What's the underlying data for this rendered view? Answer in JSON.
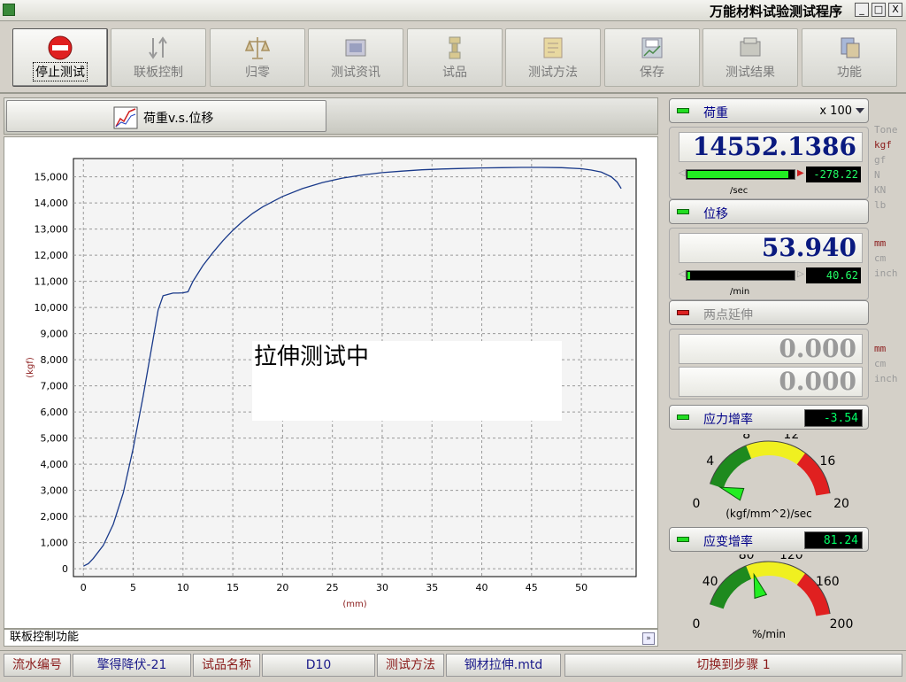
{
  "window": {
    "title": "万能材料试验测试程序",
    "btn_min": "_",
    "btn_max": "□",
    "btn_close": "X"
  },
  "toolbar": [
    {
      "label": "停止测试",
      "icon": "stop-icon",
      "active": true
    },
    {
      "label": "联板控制",
      "icon": "updown-icon",
      "active": false
    },
    {
      "label": "归零",
      "icon": "balance-icon",
      "active": false
    },
    {
      "label": "测试资讯",
      "icon": "info-icon",
      "active": false
    },
    {
      "label": "试品",
      "icon": "specimen-icon",
      "active": false
    },
    {
      "label": "测试方法",
      "icon": "method-icon",
      "active": false
    },
    {
      "label": "保存",
      "icon": "save-icon",
      "active": false
    },
    {
      "label": "测试结果",
      "icon": "results-icon",
      "active": false
    },
    {
      "label": "功能",
      "icon": "function-icon",
      "active": false
    }
  ],
  "tab": {
    "label": "荷重v.s.位移"
  },
  "overlay": {
    "text": "拉伸测试中"
  },
  "status_line": {
    "text": "联板控制功能",
    "expand": "»"
  },
  "chart_data": {
    "type": "line",
    "title": "",
    "xlabel": "(mm)",
    "ylabel": "(kgf)",
    "xlim": [
      -1,
      55.5
    ],
    "ylim": [
      -300,
      15700
    ],
    "x_ticks": [
      0,
      5,
      10,
      15,
      20,
      25,
      30,
      35,
      40,
      45,
      50
    ],
    "y_ticks": [
      0,
      1000,
      2000,
      3000,
      4000,
      5000,
      6000,
      7000,
      8000,
      9000,
      10000,
      11000,
      12000,
      13000,
      14000,
      15000
    ],
    "y_tick_labels": [
      "0",
      "1,000",
      "2,000",
      "3,000",
      "4,000",
      "5,000",
      "6,000",
      "7,000",
      "8,000",
      "9,000",
      "10,000",
      "11,000",
      "12,000",
      "13,000",
      "14,000",
      "15,000"
    ],
    "grid": true,
    "color": "#1a3a8a",
    "series": [
      {
        "x": [
          0,
          0.5,
          1,
          2,
          3,
          4,
          5,
          6,
          7,
          7.5,
          8,
          8.5,
          9,
          9.5,
          10,
          10.5,
          11,
          12,
          13,
          14,
          15,
          16,
          17,
          18,
          19,
          20,
          22,
          24,
          26,
          28,
          30,
          32,
          34,
          36,
          38,
          40,
          42,
          44,
          46,
          48,
          50,
          51,
          52,
          53,
          53.6,
          54
        ],
        "y": [
          100,
          200,
          400,
          900,
          1700,
          2900,
          4600,
          6600,
          8800,
          9900,
          10450,
          10500,
          10550,
          10550,
          10560,
          10600,
          11000,
          11600,
          12100,
          12550,
          12950,
          13300,
          13600,
          13850,
          14050,
          14250,
          14550,
          14780,
          14950,
          15070,
          15160,
          15220,
          15270,
          15300,
          15320,
          15340,
          15350,
          15360,
          15360,
          15350,
          15310,
          15260,
          15180,
          15000,
          14800,
          14552
        ]
      }
    ]
  },
  "load": {
    "label": "荷重",
    "scale": "x 100",
    "value": "14552.1386",
    "rate": "-278.22",
    "rate_unit": "/sec",
    "bar_fraction": 0.95
  },
  "load_units": [
    "Tone",
    "kgf",
    "gf",
    "N",
    "KN",
    "lb"
  ],
  "load_unit_selected": "kgf",
  "displacement": {
    "label": "位移",
    "value": "53.940",
    "rate": "40.62",
    "rate_unit": "/min",
    "bar_fraction": 0.02
  },
  "disp_units": [
    "mm",
    "cm",
    "inch"
  ],
  "disp_unit_selected": "mm",
  "extension": {
    "label": "两点延伸",
    "value1": "0.000",
    "value2": "0.000"
  },
  "ext_units": [
    "mm",
    "cm",
    "inch"
  ],
  "ext_unit_selected": "mm",
  "stress_rate": {
    "label": "应力增率",
    "value": "-3.54",
    "unit": "(kgf/mm^2)/sec",
    "ticks": [
      "0",
      "4",
      "8",
      "12",
      "16",
      "20"
    ],
    "min": 0,
    "max": 20,
    "needle": 2
  },
  "strain_rate": {
    "label": "应变增率",
    "value": "81.24",
    "unit": "%/min",
    "ticks": [
      "0",
      "40",
      "80",
      "120",
      "160",
      "200"
    ],
    "min": 0,
    "max": 200,
    "needle": 81.24
  },
  "bottom": [
    {
      "text": "流水编号",
      "kind": "lbl"
    },
    {
      "text": "擎得降伏-21",
      "kind": "val"
    },
    {
      "text": "试品名称",
      "kind": "lbl"
    },
    {
      "text": "D10",
      "kind": "val"
    },
    {
      "text": "测试方法",
      "kind": "lbl"
    },
    {
      "text": "钢材拉伸.mtd",
      "kind": "val"
    },
    {
      "text": "切换到步骤 1",
      "kind": "lbl"
    }
  ]
}
